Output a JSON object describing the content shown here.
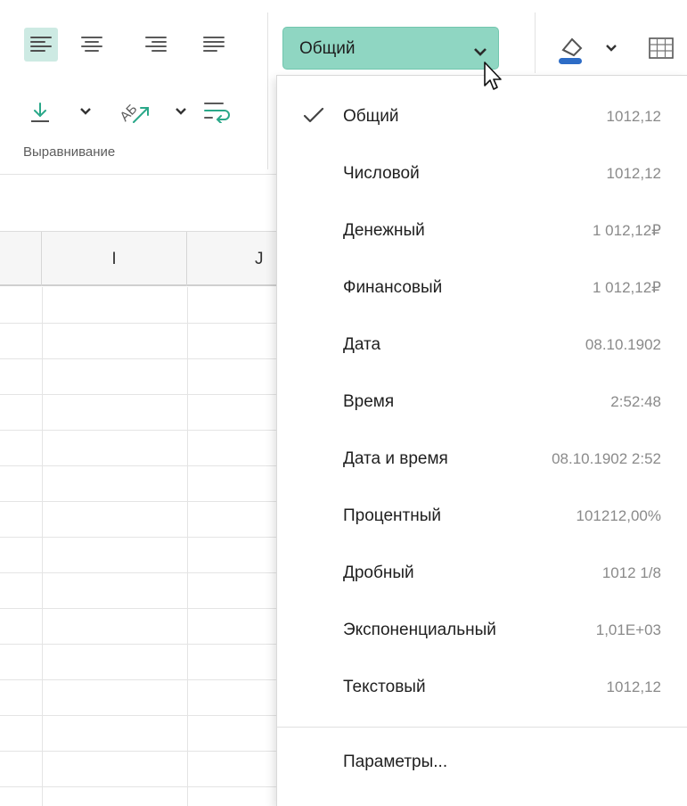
{
  "ribbon": {
    "alignment_group_label": "Выравнивание",
    "format_combo_value": "Общий",
    "accent_color": "#8fd6c2"
  },
  "sheet": {
    "columns": [
      "I",
      "J"
    ]
  },
  "format_menu": {
    "items": [
      {
        "label": "Общий",
        "sample": "1012,12",
        "checked": true
      },
      {
        "label": "Числовой",
        "sample": "1012,12"
      },
      {
        "label": "Денежный",
        "sample": "1 012,12₽"
      },
      {
        "label": "Финансовый",
        "sample": "1 012,12₽"
      },
      {
        "label": "Дата",
        "sample": "08.10.1902"
      },
      {
        "label": "Время",
        "sample": "2:52:48"
      },
      {
        "label": "Дата и время",
        "sample": "08.10.1902 2:52"
      },
      {
        "label": "Процентный",
        "sample": "101212,00%"
      },
      {
        "label": "Дробный",
        "sample": "1012 1/8"
      },
      {
        "label": "Экспоненциальный",
        "sample": "1,01E+03"
      },
      {
        "label": "Текстовый",
        "sample": "1012,12"
      }
    ],
    "parameters_label": "Параметры..."
  },
  "icons": {
    "align_left": "align-left-icon",
    "align_center": "align-center-icon",
    "align_right": "align-right-icon",
    "justify": "align-justify-icon",
    "vertical_align": "align-bottom-icon",
    "text_orientation": "text-orientation-icon",
    "wrap_text": "wrap-text-icon",
    "fill_color": "fill-color-icon",
    "borders": "borders-icon",
    "checkmark": "checkmark-icon",
    "cursor": "mouse-pointer-icon"
  }
}
